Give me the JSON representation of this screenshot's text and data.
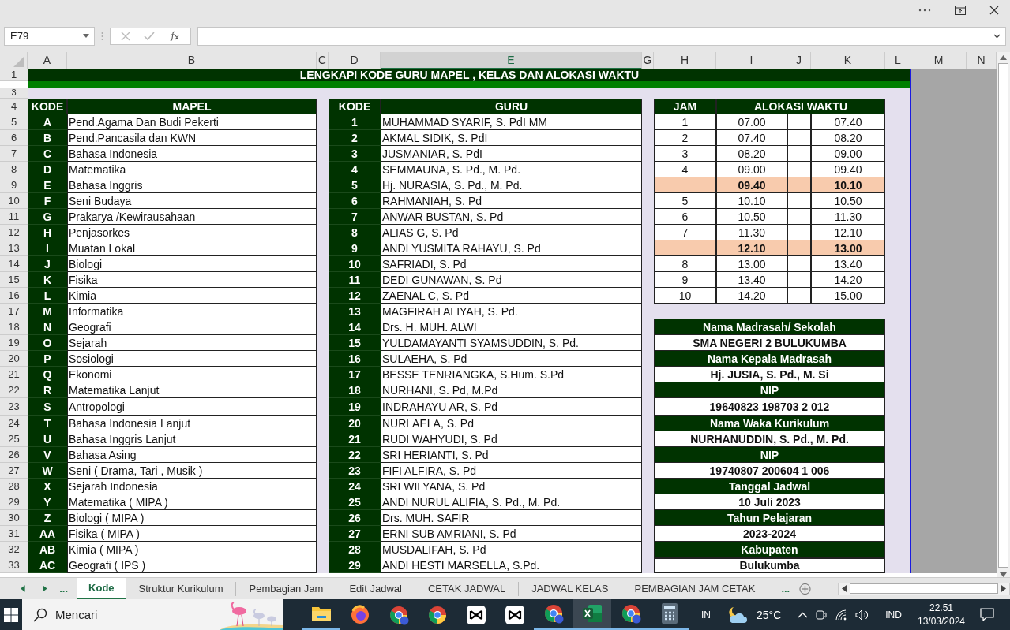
{
  "name_box": "E79",
  "columns": [
    {
      "label": "A",
      "selected": false
    },
    {
      "label": "B",
      "selected": false
    },
    {
      "label": "C",
      "selected": false
    },
    {
      "label": "D",
      "selected": false
    },
    {
      "label": "E",
      "selected": true
    },
    {
      "label": "G",
      "selected": false
    },
    {
      "label": "H",
      "selected": false
    },
    {
      "label": "I",
      "selected": false
    },
    {
      "label": "J",
      "selected": false
    },
    {
      "label": "K",
      "selected": false
    },
    {
      "label": "L",
      "selected": false
    },
    {
      "label": "M",
      "selected": false
    },
    {
      "label": "N",
      "selected": false
    }
  ],
  "row_numbers": [
    "1",
    "3",
    "4",
    "5",
    "6",
    "7",
    "8",
    "9",
    "10",
    "11",
    "12",
    "13",
    "14",
    "15",
    "16",
    "17",
    "18",
    "19",
    "20",
    "21",
    "22",
    "23",
    "24",
    "25",
    "26",
    "27",
    "28",
    "29",
    "30",
    "31",
    "32",
    "33"
  ],
  "title": "LENGKAPI KODE GURU MAPEL , KELAS DAN ALOKASI WAKTU",
  "mapel_table": {
    "headers": [
      "KODE",
      "MAPEL"
    ],
    "rows": [
      {
        "kode": "A",
        "mapel": "Pend.Agama Dan Budi Pekerti"
      },
      {
        "kode": "B",
        "mapel": "Pend.Pancasila dan KWN"
      },
      {
        "kode": "C",
        "mapel": "Bahasa Indonesia"
      },
      {
        "kode": "D",
        "mapel": "Matematika"
      },
      {
        "kode": "E",
        "mapel": "Bahasa Inggris"
      },
      {
        "kode": "F",
        "mapel": "Seni Budaya"
      },
      {
        "kode": "G",
        "mapel": "Prakarya /Kewirausahaan"
      },
      {
        "kode": "H",
        "mapel": "Penjasorkes"
      },
      {
        "kode": "I",
        "mapel": "Muatan Lokal"
      },
      {
        "kode": "J",
        "mapel": "Biologi"
      },
      {
        "kode": "K",
        "mapel": "Fisika"
      },
      {
        "kode": "L",
        "mapel": "Kimia"
      },
      {
        "kode": "M",
        "mapel": "Informatika"
      },
      {
        "kode": "N",
        "mapel": "Geografi"
      },
      {
        "kode": "O",
        "mapel": "Sejarah"
      },
      {
        "kode": "P",
        "mapel": "Sosiologi"
      },
      {
        "kode": "Q",
        "mapel": "Ekonomi"
      },
      {
        "kode": "R",
        "mapel": "Matematika Lanjut"
      },
      {
        "kode": "S",
        "mapel": "Antropologi"
      },
      {
        "kode": "T",
        "mapel": "Bahasa Indonesia Lanjut"
      },
      {
        "kode": "U",
        "mapel": "Bahasa Inggris Lanjut"
      },
      {
        "kode": "V",
        "mapel": "Bahasa Asing"
      },
      {
        "kode": "W",
        "mapel": "Seni ( Drama, Tari , Musik )"
      },
      {
        "kode": "X",
        "mapel": "Sejarah Indonesia"
      },
      {
        "kode": "Y",
        "mapel": "Matematika ( MIPA )"
      },
      {
        "kode": "Z",
        "mapel": "Biologi ( MIPA )"
      },
      {
        "kode": "AA",
        "mapel": "Fisika ( MIPA )"
      },
      {
        "kode": "AB",
        "mapel": "Kimia ( MIPA )"
      },
      {
        "kode": "AC",
        "mapel": "Geografi  ( IPS )"
      }
    ]
  },
  "guru_table": {
    "headers": [
      "KODE",
      "GURU"
    ],
    "rows": [
      {
        "kode": "1",
        "guru": "MUHAMMAD SYARIF, S. PdI MM"
      },
      {
        "kode": "2",
        "guru": "AKMAL SIDIK, S. PdI"
      },
      {
        "kode": "3",
        "guru": "JUSMANIAR, S. PdI"
      },
      {
        "kode": "4",
        "guru": "SEMMAUNA, S. Pd., M. Pd."
      },
      {
        "kode": "5",
        "guru": "Hj. NURASIA, S. Pd., M. Pd."
      },
      {
        "kode": "6",
        "guru": "RAHMANIAH, S. Pd"
      },
      {
        "kode": "7",
        "guru": "ANWAR BUSTAN, S. Pd"
      },
      {
        "kode": "8",
        "guru": "ALIAS G, S. Pd"
      },
      {
        "kode": "9",
        "guru": "ANDI YUSMITA RAHAYU, S. Pd"
      },
      {
        "kode": "10",
        "guru": "SAFRIADI, S. Pd"
      },
      {
        "kode": "11",
        "guru": "DEDI GUNAWAN, S. Pd"
      },
      {
        "kode": "12",
        "guru": "ZAENAL C, S. Pd"
      },
      {
        "kode": "13",
        "guru": "MAGFIRAH ALIYAH, S. Pd."
      },
      {
        "kode": "14",
        "guru": "Drs. H. MUH. ALWI"
      },
      {
        "kode": "15",
        "guru": "YULDAMAYANTI SYAMSUDDIN, S. Pd."
      },
      {
        "kode": "16",
        "guru": "SULAEHA, S. Pd"
      },
      {
        "kode": "17",
        "guru": "BESSE TENRIANGKA, S.Hum. S.Pd"
      },
      {
        "kode": "18",
        "guru": "NURHANI, S. Pd, M.Pd"
      },
      {
        "kode": "19",
        "guru": "INDRAHAYU AR, S. Pd"
      },
      {
        "kode": "20",
        "guru": "NURLAELA, S. Pd"
      },
      {
        "kode": "21",
        "guru": "RUDI WAHYUDI, S. Pd"
      },
      {
        "kode": "22",
        "guru": "SRI HERIANTI, S. Pd"
      },
      {
        "kode": "23",
        "guru": "FIFI ALFIRA, S. Pd"
      },
      {
        "kode": "24",
        "guru": "SRI WILYANA, S. Pd"
      },
      {
        "kode": "25",
        "guru": "ANDI NURUL ALIFIA, S. Pd., M. Pd."
      },
      {
        "kode": "26",
        "guru": "Drs. MUH. SAFIR"
      },
      {
        "kode": "27",
        "guru": "ERNI SUB AMRIANI, S. Pd"
      },
      {
        "kode": "28",
        "guru": "MUSDALIFAH, S. Pd"
      },
      {
        "kode": "29",
        "guru": "ANDI HESTI MARSELLA, S.Pd."
      }
    ]
  },
  "jam_table": {
    "headers": [
      "JAM",
      "ALOKASI WAKTU"
    ],
    "rows": [
      {
        "kind": "lesson",
        "jam": "1",
        "start": "07.00",
        "end": "07.40"
      },
      {
        "kind": "lesson",
        "jam": "2",
        "start": "07.40",
        "end": "08.20"
      },
      {
        "kind": "lesson",
        "jam": "3",
        "start": "08.20",
        "end": "09.00"
      },
      {
        "kind": "lesson",
        "jam": "4",
        "start": "09.00",
        "end": "09.40"
      },
      {
        "kind": "break",
        "start": "09.40",
        "end": "10.10"
      },
      {
        "kind": "lesson",
        "jam": "5",
        "start": "10.10",
        "end": "10.50"
      },
      {
        "kind": "lesson",
        "jam": "6",
        "start": "10.50",
        "end": "11.30"
      },
      {
        "kind": "lesson",
        "jam": "7",
        "start": "11.30",
        "end": "12.10"
      },
      {
        "kind": "break",
        "start": "12.10",
        "end": "13.00"
      },
      {
        "kind": "lesson",
        "jam": "8",
        "start": "13.00",
        "end": "13.40"
      },
      {
        "kind": "lesson",
        "jam": "9",
        "start": "13.40",
        "end": "14.20"
      },
      {
        "kind": "lesson",
        "jam": "10",
        "start": "14.20",
        "end": "15.00"
      }
    ]
  },
  "info": [
    {
      "label": "Nama Madrasah/ Sekolah",
      "value": "SMA NEGERI 2 BULUKUMBA"
    },
    {
      "label": "Nama Kepala Madrasah",
      "value": "Hj. JUSIA, S. Pd., M. Si"
    },
    {
      "label": "NIP",
      "value": "19640823 198703 2 012"
    },
    {
      "label": "Nama Waka Kurikulum",
      "value": "NURHANUDDIN, S. Pd., M. Pd."
    },
    {
      "label": "NIP",
      "value": "19740807 200604 1 006"
    },
    {
      "label": "Tanggal Jadwal",
      "value": "10 Juli 2023"
    },
    {
      "label": "Tahun Pelajaran",
      "value": "2023-2024"
    },
    {
      "label": "Kabupaten",
      "value": "Bulukumba"
    }
  ],
  "tab_overflow_left": "...",
  "sheet_tabs": [
    {
      "label": "Kode",
      "selected": true
    },
    {
      "label": "Struktur Kurikulum",
      "selected": false
    },
    {
      "label": "Pembagian Jam",
      "selected": false
    },
    {
      "label": "Edit Jadwal",
      "selected": false
    },
    {
      "label": "CETAK JADWAL",
      "selected": false
    },
    {
      "label": "JADWAL KELAS",
      "selected": false
    },
    {
      "label": "PEMBAGIAN JAM CETAK",
      "selected": false
    }
  ],
  "tab_overflow_right": "...",
  "taskbar": {
    "search_placeholder": "Mencari",
    "apps": [
      {
        "kind": "folder",
        "running": true,
        "selected": false
      },
      {
        "kind": "firefox",
        "running": false,
        "selected": false
      },
      {
        "kind": "chrome-badge",
        "running": false,
        "selected": false
      },
      {
        "kind": "chrome",
        "running": false,
        "selected": false
      },
      {
        "kind": "capcut",
        "running": false,
        "selected": false
      },
      {
        "kind": "capcut",
        "running": false,
        "selected": false
      },
      {
        "kind": "chrome-badge",
        "running": true,
        "selected": false
      },
      {
        "kind": "excel",
        "running": true,
        "selected": true
      },
      {
        "kind": "chrome-badge",
        "running": true,
        "selected": false
      },
      {
        "kind": "calculator",
        "running": true,
        "selected": false
      }
    ],
    "keyboard": "IN",
    "temperature": "25°C",
    "language": "IND",
    "time": "22.51",
    "date": "13/03/2024"
  }
}
